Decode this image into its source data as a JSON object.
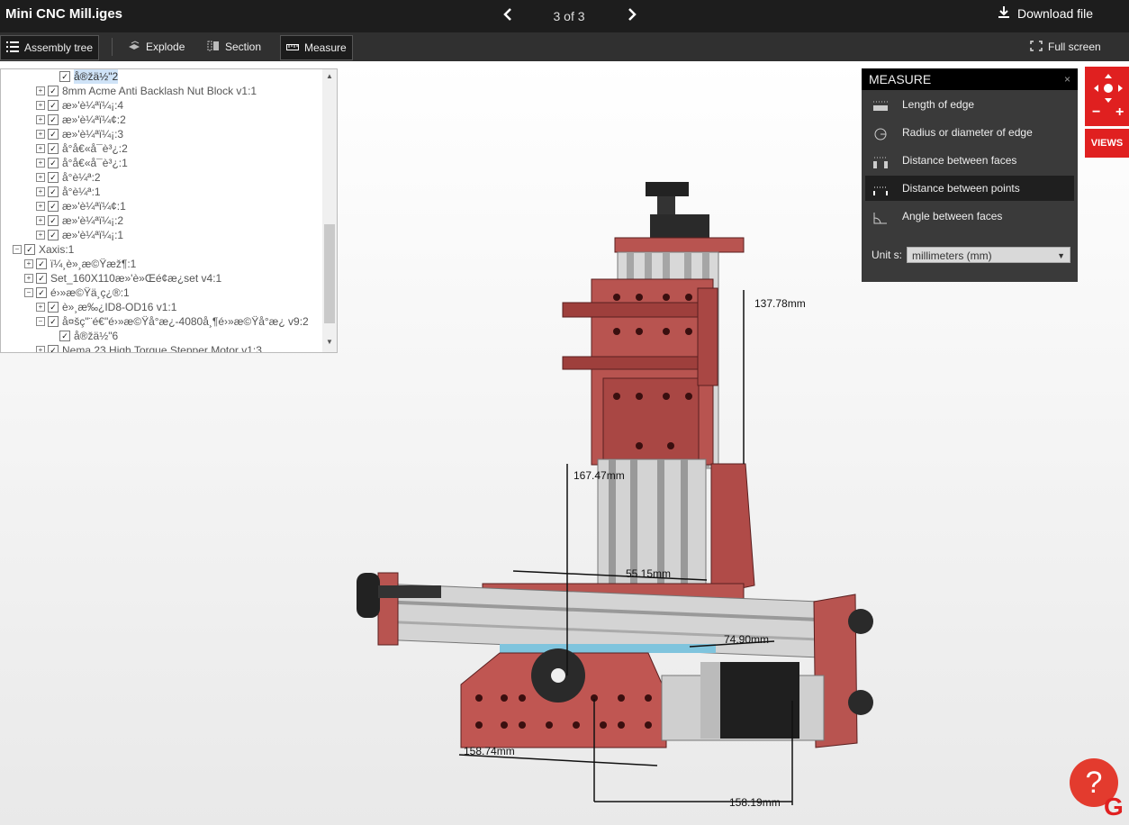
{
  "app": {
    "title": "Mini CNC Mill.iges",
    "pager": {
      "prev_icon": "chevron-left-icon",
      "label": "3 of 3",
      "next_icon": "chevron-right-icon"
    },
    "download_label": "Download file"
  },
  "toolbar": {
    "assembly_tree": "Assembly tree",
    "explode": "Explode",
    "section": "Section",
    "measure": "Measure",
    "fullscreen": "Full screen"
  },
  "tree": {
    "items": [
      {
        "label": "å®žä½\"2",
        "selected": true
      },
      {
        "label": "8mm Acme Anti Backlash Nut Block v1:1"
      },
      {
        "label": "æ»'è¼ªï¼¡:4"
      },
      {
        "label": "æ»'è¼ªï¼¢:2"
      },
      {
        "label": "æ»'è¼ªï¼¡:3"
      },
      {
        "label": "å°å€«å¯è³¿:2"
      },
      {
        "label": "å°å€«å¯è³¿:1"
      },
      {
        "label": "å°è¼ª:2"
      },
      {
        "label": "å°è¼ª:1"
      },
      {
        "label": "æ»'è¼ªï¼¢:1"
      },
      {
        "label": "æ»'è¼ªï¼¡:2"
      },
      {
        "label": "æ»'è¼ªï¼¡:1"
      },
      {
        "label": "Xaxis:1"
      },
      {
        "label": "ï¼¸è»¸æ©Ÿæž¶:1"
      },
      {
        "label": "Set_160X110æ»'è»Œé¢æ¿set v4:1"
      },
      {
        "label": "é›»æ©Ÿä¸ç¿®:1"
      },
      {
        "label": "è»¸æ‰¿ID8-OD16 v1:1"
      },
      {
        "label": "å¤šç\"¨é€\"é›»æ©Ÿå°æ¿-4080å¸¶é›»æ©Ÿå°æ¿ v9:2"
      },
      {
        "label": "å®žä½\"6"
      },
      {
        "label": "Nema 23 High Torque Stepper Motor v1:3"
      }
    ]
  },
  "measure": {
    "title": "MEASURE",
    "close": "×",
    "options": [
      {
        "label": "Length of edge",
        "icon": "edge-length-icon"
      },
      {
        "label": "Radius or diameter of edge",
        "icon": "radius-icon"
      },
      {
        "label": "Distance between faces",
        "icon": "faces-distance-icon"
      },
      {
        "label": "Distance between points",
        "icon": "points-distance-icon",
        "active": true
      },
      {
        "label": "Angle between faces",
        "icon": "angle-icon"
      }
    ],
    "units_label": "Unit s:",
    "units_value": "millimeters (mm)"
  },
  "nav": {
    "views": "VIEWS",
    "minus": "−",
    "plus": "+"
  },
  "dimensions": {
    "d1": "137.78mm",
    "d2": "167.47mm",
    "d3": "55.15mm",
    "d4": "74.90mm",
    "d5": "158.74mm",
    "d6": "158.19mm"
  },
  "help": "?",
  "brand": "G"
}
